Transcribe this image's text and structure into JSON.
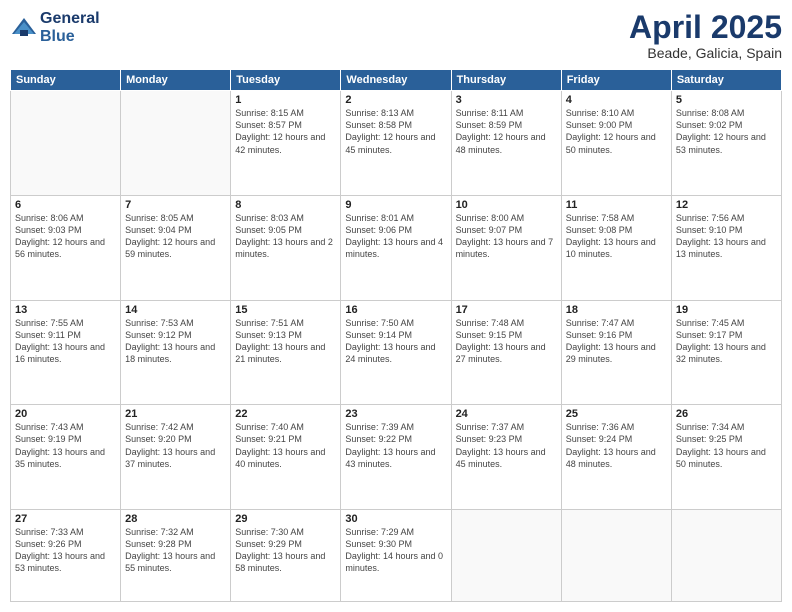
{
  "logo": {
    "line1": "General",
    "line2": "Blue"
  },
  "title": "April 2025",
  "subtitle": "Beade, Galicia, Spain",
  "weekdays": [
    "Sunday",
    "Monday",
    "Tuesday",
    "Wednesday",
    "Thursday",
    "Friday",
    "Saturday"
  ],
  "weeks": [
    [
      {
        "day": "",
        "info": ""
      },
      {
        "day": "",
        "info": ""
      },
      {
        "day": "1",
        "info": "Sunrise: 8:15 AM\nSunset: 8:57 PM\nDaylight: 12 hours and 42 minutes."
      },
      {
        "day": "2",
        "info": "Sunrise: 8:13 AM\nSunset: 8:58 PM\nDaylight: 12 hours and 45 minutes."
      },
      {
        "day": "3",
        "info": "Sunrise: 8:11 AM\nSunset: 8:59 PM\nDaylight: 12 hours and 48 minutes."
      },
      {
        "day": "4",
        "info": "Sunrise: 8:10 AM\nSunset: 9:00 PM\nDaylight: 12 hours and 50 minutes."
      },
      {
        "day": "5",
        "info": "Sunrise: 8:08 AM\nSunset: 9:02 PM\nDaylight: 12 hours and 53 minutes."
      }
    ],
    [
      {
        "day": "6",
        "info": "Sunrise: 8:06 AM\nSunset: 9:03 PM\nDaylight: 12 hours and 56 minutes."
      },
      {
        "day": "7",
        "info": "Sunrise: 8:05 AM\nSunset: 9:04 PM\nDaylight: 12 hours and 59 minutes."
      },
      {
        "day": "8",
        "info": "Sunrise: 8:03 AM\nSunset: 9:05 PM\nDaylight: 13 hours and 2 minutes."
      },
      {
        "day": "9",
        "info": "Sunrise: 8:01 AM\nSunset: 9:06 PM\nDaylight: 13 hours and 4 minutes."
      },
      {
        "day": "10",
        "info": "Sunrise: 8:00 AM\nSunset: 9:07 PM\nDaylight: 13 hours and 7 minutes."
      },
      {
        "day": "11",
        "info": "Sunrise: 7:58 AM\nSunset: 9:08 PM\nDaylight: 13 hours and 10 minutes."
      },
      {
        "day": "12",
        "info": "Sunrise: 7:56 AM\nSunset: 9:10 PM\nDaylight: 13 hours and 13 minutes."
      }
    ],
    [
      {
        "day": "13",
        "info": "Sunrise: 7:55 AM\nSunset: 9:11 PM\nDaylight: 13 hours and 16 minutes."
      },
      {
        "day": "14",
        "info": "Sunrise: 7:53 AM\nSunset: 9:12 PM\nDaylight: 13 hours and 18 minutes."
      },
      {
        "day": "15",
        "info": "Sunrise: 7:51 AM\nSunset: 9:13 PM\nDaylight: 13 hours and 21 minutes."
      },
      {
        "day": "16",
        "info": "Sunrise: 7:50 AM\nSunset: 9:14 PM\nDaylight: 13 hours and 24 minutes."
      },
      {
        "day": "17",
        "info": "Sunrise: 7:48 AM\nSunset: 9:15 PM\nDaylight: 13 hours and 27 minutes."
      },
      {
        "day": "18",
        "info": "Sunrise: 7:47 AM\nSunset: 9:16 PM\nDaylight: 13 hours and 29 minutes."
      },
      {
        "day": "19",
        "info": "Sunrise: 7:45 AM\nSunset: 9:17 PM\nDaylight: 13 hours and 32 minutes."
      }
    ],
    [
      {
        "day": "20",
        "info": "Sunrise: 7:43 AM\nSunset: 9:19 PM\nDaylight: 13 hours and 35 minutes."
      },
      {
        "day": "21",
        "info": "Sunrise: 7:42 AM\nSunset: 9:20 PM\nDaylight: 13 hours and 37 minutes."
      },
      {
        "day": "22",
        "info": "Sunrise: 7:40 AM\nSunset: 9:21 PM\nDaylight: 13 hours and 40 minutes."
      },
      {
        "day": "23",
        "info": "Sunrise: 7:39 AM\nSunset: 9:22 PM\nDaylight: 13 hours and 43 minutes."
      },
      {
        "day": "24",
        "info": "Sunrise: 7:37 AM\nSunset: 9:23 PM\nDaylight: 13 hours and 45 minutes."
      },
      {
        "day": "25",
        "info": "Sunrise: 7:36 AM\nSunset: 9:24 PM\nDaylight: 13 hours and 48 minutes."
      },
      {
        "day": "26",
        "info": "Sunrise: 7:34 AM\nSunset: 9:25 PM\nDaylight: 13 hours and 50 minutes."
      }
    ],
    [
      {
        "day": "27",
        "info": "Sunrise: 7:33 AM\nSunset: 9:26 PM\nDaylight: 13 hours and 53 minutes."
      },
      {
        "day": "28",
        "info": "Sunrise: 7:32 AM\nSunset: 9:28 PM\nDaylight: 13 hours and 55 minutes."
      },
      {
        "day": "29",
        "info": "Sunrise: 7:30 AM\nSunset: 9:29 PM\nDaylight: 13 hours and 58 minutes."
      },
      {
        "day": "30",
        "info": "Sunrise: 7:29 AM\nSunset: 9:30 PM\nDaylight: 14 hours and 0 minutes."
      },
      {
        "day": "",
        "info": ""
      },
      {
        "day": "",
        "info": ""
      },
      {
        "day": "",
        "info": ""
      }
    ]
  ]
}
